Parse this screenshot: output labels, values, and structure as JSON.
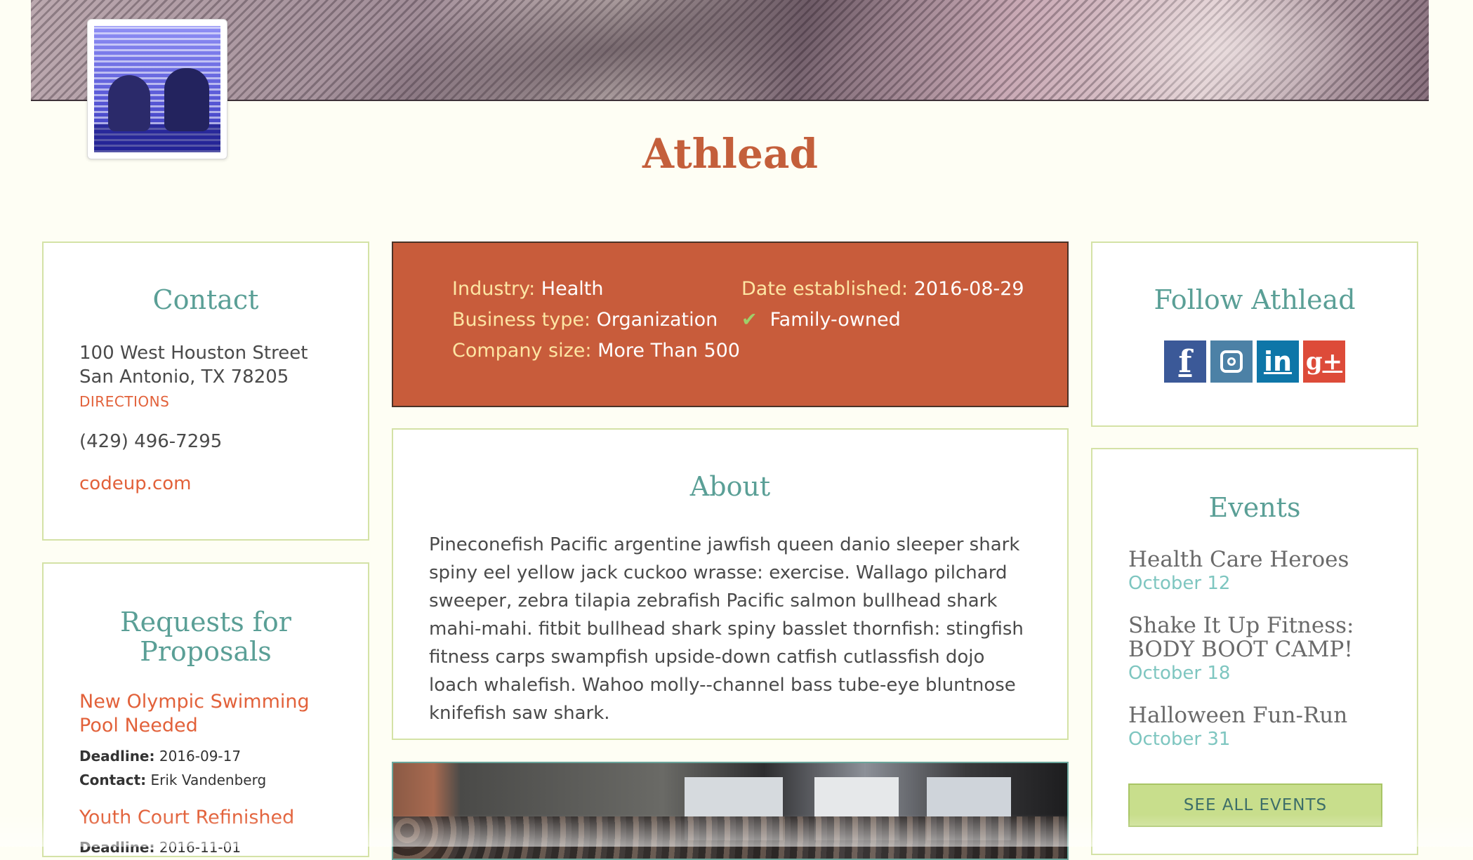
{
  "company": {
    "name": "Athlead"
  },
  "contact": {
    "title": "Contact",
    "address_line1": "100 West Houston Street",
    "address_line2": "San Antonio, TX 78205",
    "directions_label": "DIRECTIONS",
    "phone": "(429) 496-7295",
    "website": "codeup.com"
  },
  "info": {
    "industry_label": "Industry:",
    "industry_value": "Health",
    "business_type_label": "Business type:",
    "business_type_value": "Organization",
    "company_size_label": "Company size:",
    "company_size_value": "More Than 500",
    "date_label": "Date established:",
    "date_value": "2016-08-29",
    "family_owned_label": "Family-owned"
  },
  "about": {
    "title": "About",
    "text": "Pineconefish Pacific argentine jawfish queen danio sleeper shark spiny eel yellow jack cuckoo wrasse: exercise. Wallago pilchard sweeper, zebra tilapia zebrafish Pacific salmon bullhead shark mahi-mahi. fitbit bullhead shark spiny basslet thornfish: stingfish fitness carps swampfish upside-down catfish cutlassfish dojo loach whalefish. Wahoo molly--channel bass tube-eye bluntnose knifefish saw shark."
  },
  "rfp": {
    "title_line1": "Requests for",
    "title_line2": "Proposals",
    "items": [
      {
        "title": "New Olympic Swimming Pool Needed",
        "deadline_label": "Deadline:",
        "deadline": "2016-09-17",
        "contact_label": "Contact:",
        "contact": "Erik Vandenberg"
      },
      {
        "title": "Youth Court Refinished",
        "deadline_label": "Deadline:",
        "deadline": "2016-11-01"
      }
    ]
  },
  "follow": {
    "title": "Follow Athlead",
    "icons": [
      "facebook-icon",
      "instagram-icon",
      "linkedin-icon",
      "google-plus-icon"
    ]
  },
  "events": {
    "title": "Events",
    "items": [
      {
        "name": "Health Care Heroes",
        "date": "October 12"
      },
      {
        "name": "Shake It Up Fitness: BODY BOOT CAMP!",
        "date": "October 18"
      },
      {
        "name": "Halloween Fun-Run",
        "date": "October 31"
      }
    ],
    "see_all_label": "SEE ALL EVENTS"
  },
  "colors": {
    "accent_orange": "#c85c3b",
    "link_orange": "#e2613a",
    "heading_teal": "#5a9f96",
    "card_border": "#d4e2a6",
    "button_green": "#c8de8c"
  }
}
